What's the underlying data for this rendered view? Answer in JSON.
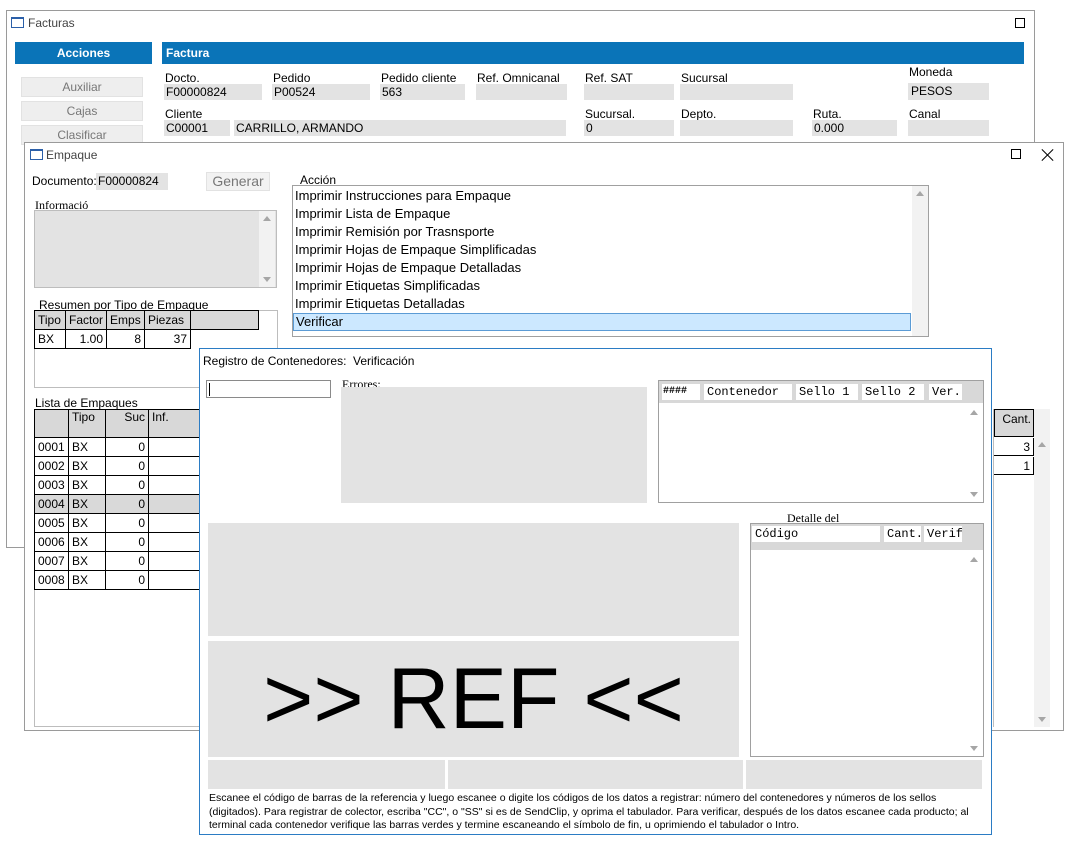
{
  "facturas": {
    "title": "Facturas",
    "acciones_label": "Acciones",
    "factura_label": "Factura",
    "buttons": [
      "Auxiliar",
      "Cajas",
      "Clasificar"
    ],
    "fields": {
      "docto_label": "Docto.",
      "docto_value": "F00000824",
      "pedido_label": "Pedido",
      "pedido_value": "P00524",
      "pedido_cliente_label": "Pedido cliente",
      "pedido_cliente_value": "563",
      "ref_omnicanal_label": "Ref. Omnicanal",
      "ref_sat_label": "Ref. SAT",
      "sucursal_label": "Sucursal",
      "moneda_label": "Moneda",
      "moneda_value": "PESOS",
      "cliente_label": "Cliente",
      "cliente_code": "C00001",
      "cliente_name": "CARRILLO, ARMANDO",
      "sucursal2_label": "Sucursal.",
      "sucursal2_value": "0",
      "depto_label": "Depto.",
      "ruta_label": "Ruta.",
      "ruta_value": "0.000",
      "canal_label": "Canal"
    }
  },
  "empaque": {
    "title": "Empaque",
    "documento_label": "Documento:",
    "documento_value": "F00000824",
    "generar_label": "Generar",
    "informacion_label": "Informació",
    "resumen_label": "Resumen por Tipo de Empaque",
    "resumen_headers": [
      "Tipo",
      "Factor",
      "Emps",
      "Piezas"
    ],
    "resumen_rows": [
      [
        "BX",
        "1.00",
        "8",
        "37"
      ]
    ],
    "lista_label": "Lista de Empaques",
    "lista_headers": [
      "",
      "Tipo",
      "Suc",
      "Inf."
    ],
    "lista_rows": [
      [
        "0001",
        "BX",
        "0"
      ],
      [
        "0002",
        "BX",
        "0"
      ],
      [
        "0003",
        "BX",
        "0"
      ],
      [
        "0004",
        "BX",
        "0"
      ],
      [
        "0005",
        "BX",
        "0"
      ],
      [
        "0006",
        "BX",
        "0"
      ],
      [
        "0007",
        "BX",
        "0"
      ],
      [
        "0008",
        "BX",
        "0"
      ]
    ],
    "accion_label": "Acción",
    "acciones": [
      "Imprimir Instrucciones para Empaque",
      "Imprimir Lista de Empaque",
      "Imprimir Remisión por Trasnsporte",
      "Imprimir Hojas de Empaque Simplificadas",
      "Imprimir Hojas de Empaque Detalladas",
      "Imprimir Etiquetas Simplificadas",
      "Imprimir Etiquetas Detalladas",
      "Verificar"
    ],
    "cant_header": "Cant.",
    "cant_values": [
      "3",
      "1"
    ]
  },
  "registro": {
    "title_left": "Registro de Contenedores:",
    "title_right": "Verificación",
    "errores_label": "Errores:",
    "cont_headers": [
      "####",
      "Contenedor",
      "Sello 1",
      "Sello 2",
      "Ver."
    ],
    "detalle_label": "Detalle del",
    "detalle_headers": [
      "Código",
      "Cant.",
      "Verif."
    ],
    "ref_text": ">> REF <<",
    "instructions": "Escanee el código de barras de la referencia y luego escanee o digite los códigos de los datos a registrar: número del contenedores y números de los sellos (digitados). Para registrar de colector, escriba \"CC\", o \"SS\" si es de SendClip, y oprima el tabulador. Para verificar, después de los datos escanee cada producto; al terminal cada contenedor verifique las barras verdes y termine escaneando el símbolo de fin, u oprimiendo el tabulador o Intro."
  }
}
